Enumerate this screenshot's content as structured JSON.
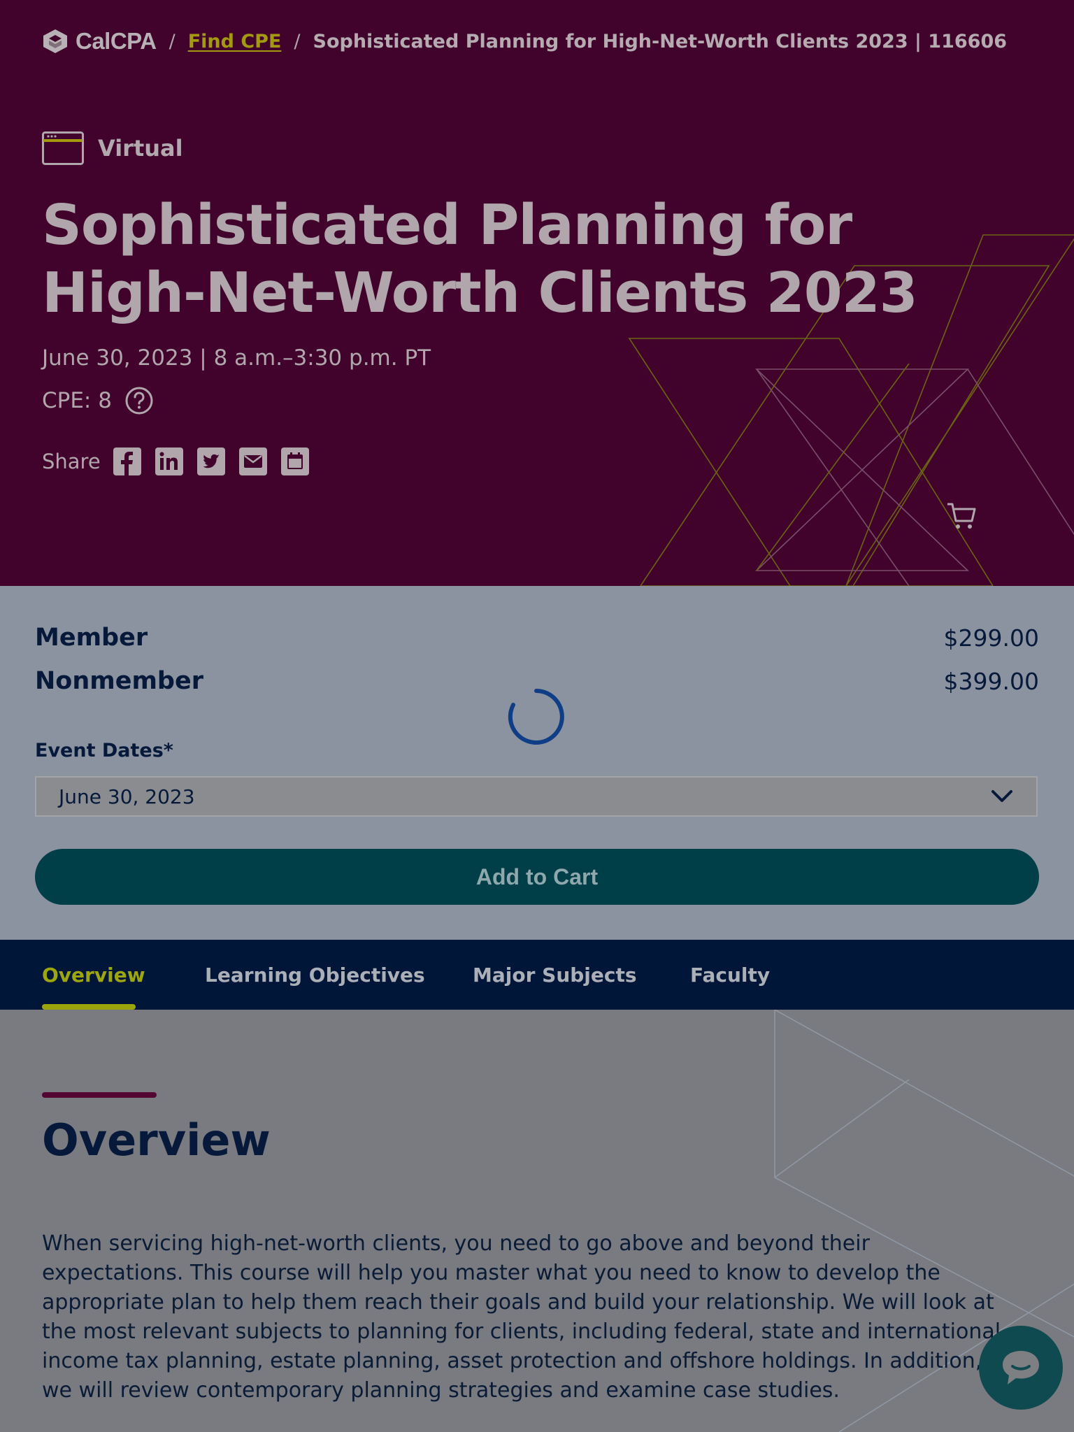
{
  "breadcrumb": {
    "brand": "CalCPA",
    "separator": "/",
    "link": "Find CPE",
    "current": "Sophisticated Planning for High-Net-Worth Clients 2023 | 116606"
  },
  "hero": {
    "format_icon": "browser-window-icon",
    "format_label": "Virtual",
    "title": "Sophisticated Planning for High-Net-Worth Clients 2023",
    "date_line": "June 30, 2023 | 8 a.m.–3:30 p.m. PT",
    "cpe_label": "CPE: 8",
    "help_icon": "question-circle-icon",
    "share_label": "Share",
    "share_icons": [
      "facebook-icon",
      "linkedin-icon",
      "twitter-icon",
      "email-icon",
      "calendar-icon"
    ],
    "cart_icon": "cart-icon"
  },
  "purchase": {
    "prices": [
      {
        "label": "Member",
        "value": "$299.00"
      },
      {
        "label": "Nonmember",
        "value": "$399.00"
      }
    ],
    "event_dates_label": "Event Dates*",
    "event_dates_value": "June 30, 2023",
    "add_to_cart": "Add to Cart"
  },
  "tabs": [
    {
      "label": "Overview",
      "active": true
    },
    {
      "label": "Learning Objectives",
      "active": false
    },
    {
      "label": "Major Subjects",
      "active": false
    },
    {
      "label": "Faculty",
      "active": false
    }
  ],
  "overview": {
    "heading": "Overview",
    "lines": [
      "When servicing high-net-worth clients, you need to go above and beyond their",
      "expectations. This course will help you master what you need to know to develop the",
      "appropriate plan to help them reach their goals and build your relationship. We will look at",
      "the most relevant subjects to planning for clients, including federal, state and international",
      "income tax planning, estate planning, asset protection and offshore holdings. In addition,",
      "we will review contemporary planning strategies and examine case studies."
    ]
  },
  "colors": {
    "hero_bg": "#41032b",
    "accent_olive": "#9ea60d",
    "navy": "#06193b",
    "teal": "#003e48"
  }
}
